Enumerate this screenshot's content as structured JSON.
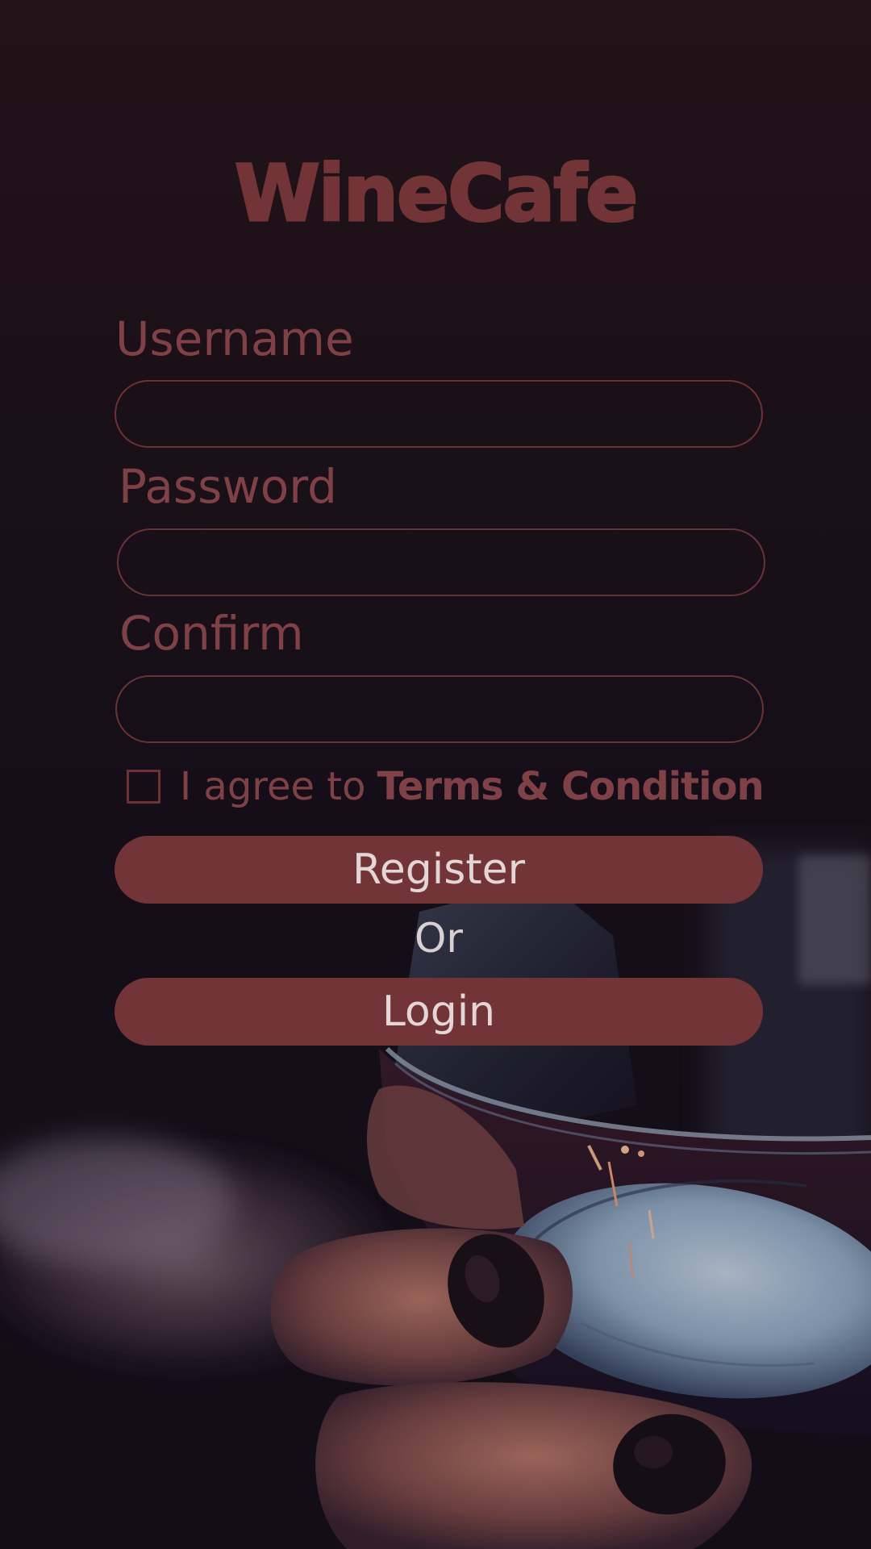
{
  "app": {
    "logo_text": "WineCafe"
  },
  "form": {
    "username_label": "Username",
    "password_label": "Password",
    "confirm_label": "Confirm",
    "username_value": "",
    "password_value": "",
    "confirm_value": "",
    "agree_text": "I agree to",
    "terms_link": "Terms & Condition",
    "agree_checked": false
  },
  "actions": {
    "register_label": "Register",
    "or_text": "Or",
    "login_label": "Login"
  },
  "colors": {
    "accent": "#733437",
    "label": "#7f4146",
    "button_text": "#e2d6d6",
    "background": "#160f18"
  }
}
